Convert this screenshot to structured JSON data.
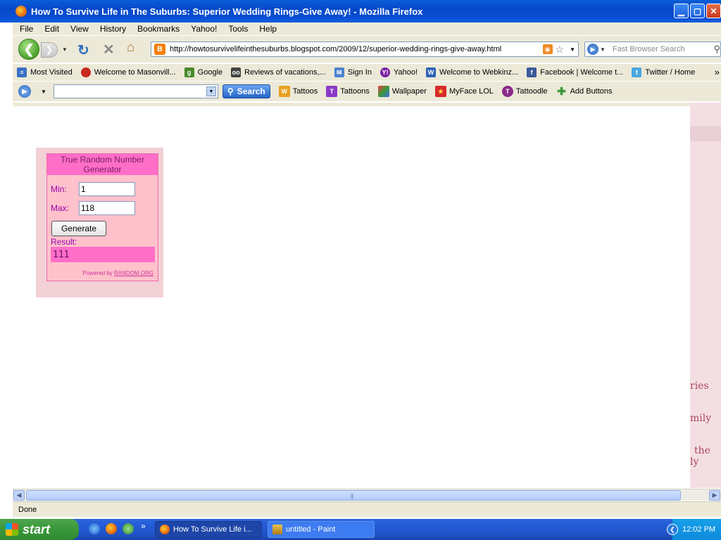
{
  "window": {
    "title": "How To Survive Life in The Suburbs: Superior Wedding Rings-Give Away! - Mozilla Firefox"
  },
  "menu": [
    "File",
    "Edit",
    "View",
    "History",
    "Bookmarks",
    "Yahoo!",
    "Tools",
    "Help"
  ],
  "nav": {
    "url": "http://howtosurvivelifeinthesuburbs.blogspot.com/2009/12/superior-wedding-rings-give-away.html",
    "search_placeholder": "Fast Browser Search"
  },
  "bookmarks": [
    {
      "label": "Most Visited",
      "icon": "list-icon",
      "color": "#3a6fc4"
    },
    {
      "label": "Welcome to Masonvill...",
      "icon": "apple-icon",
      "color": "#c8281e"
    },
    {
      "label": "Google",
      "icon": "google-icon",
      "color": "#4a8a2a"
    },
    {
      "label": "Reviews of vacations,...",
      "icon": "owl-icon",
      "color": "#444444"
    },
    {
      "label": "Sign In",
      "icon": "msn-icon",
      "color": "#4a82d0"
    },
    {
      "label": "Yahoo!",
      "icon": "yahoo-icon",
      "color": "#7b1fa2"
    },
    {
      "label": "Welcome to Webkinz...",
      "icon": "webkinz-icon",
      "color": "#2e62b8"
    },
    {
      "label": "Facebook | Welcome t...",
      "icon": "facebook-icon",
      "color": "#3b5998"
    },
    {
      "label": "Twitter / Home",
      "icon": "twitter-icon",
      "color": "#4aa8e0"
    }
  ],
  "yahoo_toolbar": {
    "search_label": "Search",
    "items": [
      {
        "label": "Tattoos",
        "icon": "tattoos-icon",
        "color": "#e8a020"
      },
      {
        "label": "Tattoons",
        "icon": "tattoons-icon",
        "color": "#8a3ac8"
      },
      {
        "label": "Wallpaper",
        "icon": "wallpaper-icon",
        "color": "#3a9a3a"
      },
      {
        "label": "MyFace LOL",
        "icon": "myface-icon",
        "color": "#d82a2a"
      },
      {
        "label": "Tattoodle",
        "icon": "tattoodle-icon",
        "color": "#8a2a8a"
      },
      {
        "label": "Add Buttons",
        "icon": "plus-icon",
        "color": "#3a9a3a"
      }
    ]
  },
  "rng": {
    "title": "True Random Number Generator",
    "min_label": "Min:",
    "min_value": "1",
    "max_label": "Max:",
    "max_value": "118",
    "button": "Generate",
    "result_label": "Result:",
    "result_value": "111",
    "powered_prefix": "Powered by",
    "powered_link": "RANDOM.ORG"
  },
  "right_fragments": [
    "ries",
    "mily",
    "the",
    "ly"
  ],
  "status": "Done",
  "taskbar": {
    "start": "start",
    "tasks": [
      {
        "label": "How To Survive Life i...",
        "active": true
      },
      {
        "label": "untitled - Paint",
        "active": false
      }
    ],
    "clock": "12:02 PM"
  }
}
